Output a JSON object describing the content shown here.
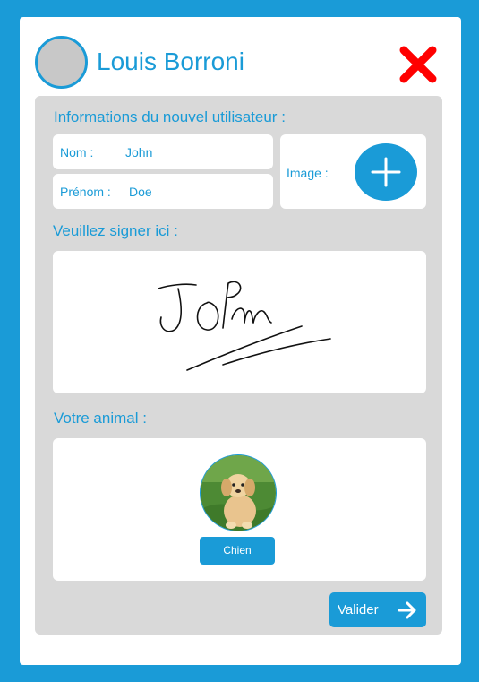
{
  "header": {
    "user_name": "Louis Borroni",
    "avatar_icon": "user-avatar-placeholder",
    "close_icon": "close-x-icon",
    "close_color": "#ff0000"
  },
  "form": {
    "section_title": "Informations du nouvel utilisateur :",
    "nom": {
      "label": "Nom :",
      "value": "John"
    },
    "prenom": {
      "label": "Prénom :",
      "value": "Doe"
    },
    "image": {
      "label": "Image :",
      "add_icon": "plus-icon"
    }
  },
  "signature": {
    "title": "Veuillez signer ici :",
    "handwritten_text": "John"
  },
  "animal": {
    "title": "Votre animal :",
    "photo": "puppy-photo",
    "button_label": "Chien"
  },
  "footer": {
    "validate_label": "Valider",
    "validate_icon": "arrow-right-icon"
  },
  "colors": {
    "accent": "#1a9bd7",
    "panel": "#d9d9d9",
    "background": "#ffffff"
  }
}
